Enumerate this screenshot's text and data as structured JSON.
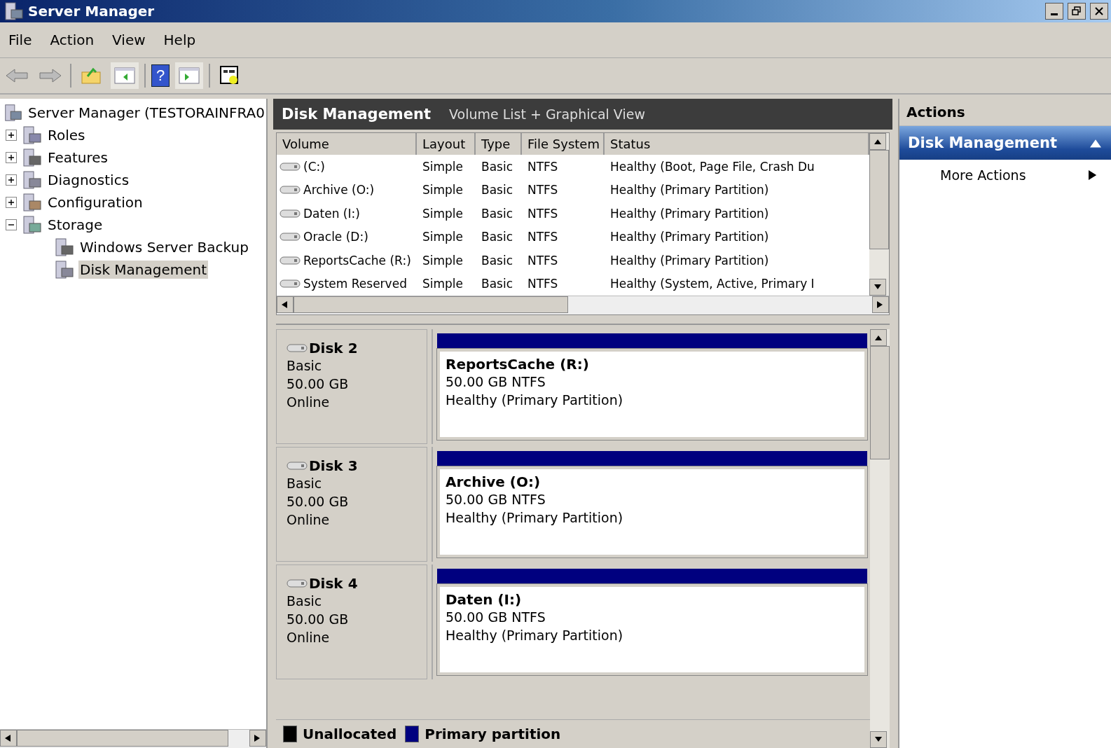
{
  "window": {
    "title": "Server Manager"
  },
  "menu": [
    "File",
    "Action",
    "View",
    "Help"
  ],
  "toolbar": {
    "help_glyph": "?"
  },
  "tree": [
    {
      "label": "Server Manager (TESTORAINFRA0",
      "selected": false,
      "children": [
        {
          "label": "Roles",
          "expanded": false,
          "selected": false
        },
        {
          "label": "Features",
          "expanded": false,
          "selected": false
        },
        {
          "label": "Diagnostics",
          "expanded": false,
          "selected": false
        },
        {
          "label": "Configuration",
          "expanded": false,
          "selected": false
        },
        {
          "label": "Storage",
          "expanded": true,
          "selected": false,
          "children": [
            {
              "label": "Windows Server Backup",
              "selected": false
            },
            {
              "label": "Disk Management",
              "selected": true
            }
          ]
        }
      ]
    }
  ],
  "center": {
    "title": "Disk Management",
    "subtitle": "Volume List + Graphical View"
  },
  "table": {
    "columns": [
      "Volume",
      "Layout",
      "Type",
      "File System",
      "Status"
    ],
    "rows": [
      [
        "(C:)",
        "Simple",
        "Basic",
        "NTFS",
        "Healthy (Boot, Page File, Crash Du"
      ],
      [
        "Archive (O:)",
        "Simple",
        "Basic",
        "NTFS",
        "Healthy (Primary Partition)"
      ],
      [
        "Daten (I:)",
        "Simple",
        "Basic",
        "NTFS",
        "Healthy (Primary Partition)"
      ],
      [
        "Oracle (D:)",
        "Simple",
        "Basic",
        "NTFS",
        "Healthy (Primary Partition)"
      ],
      [
        "ReportsCache (R:)",
        "Simple",
        "Basic",
        "NTFS",
        "Healthy (Primary Partition)"
      ],
      [
        "System Reserved",
        "Simple",
        "Basic",
        "NTFS",
        "Healthy (System, Active, Primary I"
      ]
    ]
  },
  "disks": [
    {
      "name": "Disk 2",
      "type": "Basic",
      "size": "50.00 GB",
      "state": "Online",
      "partition": {
        "name": "ReportsCache  (R:)",
        "size": "50.00 GB NTFS",
        "status": "Healthy (Primary Partition)",
        "color": "#00007f"
      }
    },
    {
      "name": "Disk 3",
      "type": "Basic",
      "size": "50.00 GB",
      "state": "Online",
      "partition": {
        "name": "Archive  (O:)",
        "size": "50.00 GB NTFS",
        "status": "Healthy (Primary Partition)",
        "color": "#00007f"
      }
    },
    {
      "name": "Disk 4",
      "type": "Basic",
      "size": "50.00 GB",
      "state": "Online",
      "partition": {
        "name": "Daten  (I:)",
        "size": "50.00 GB NTFS",
        "status": "Healthy (Primary Partition)",
        "color": "#00007f"
      }
    }
  ],
  "legend": [
    {
      "label": "Unallocated",
      "color": "#000000"
    },
    {
      "label": "Primary partition",
      "color": "#00007f"
    }
  ],
  "actions": {
    "title": "Actions",
    "section": {
      "title": "Disk Management",
      "expanded": true
    },
    "items": [
      "More Actions"
    ]
  }
}
